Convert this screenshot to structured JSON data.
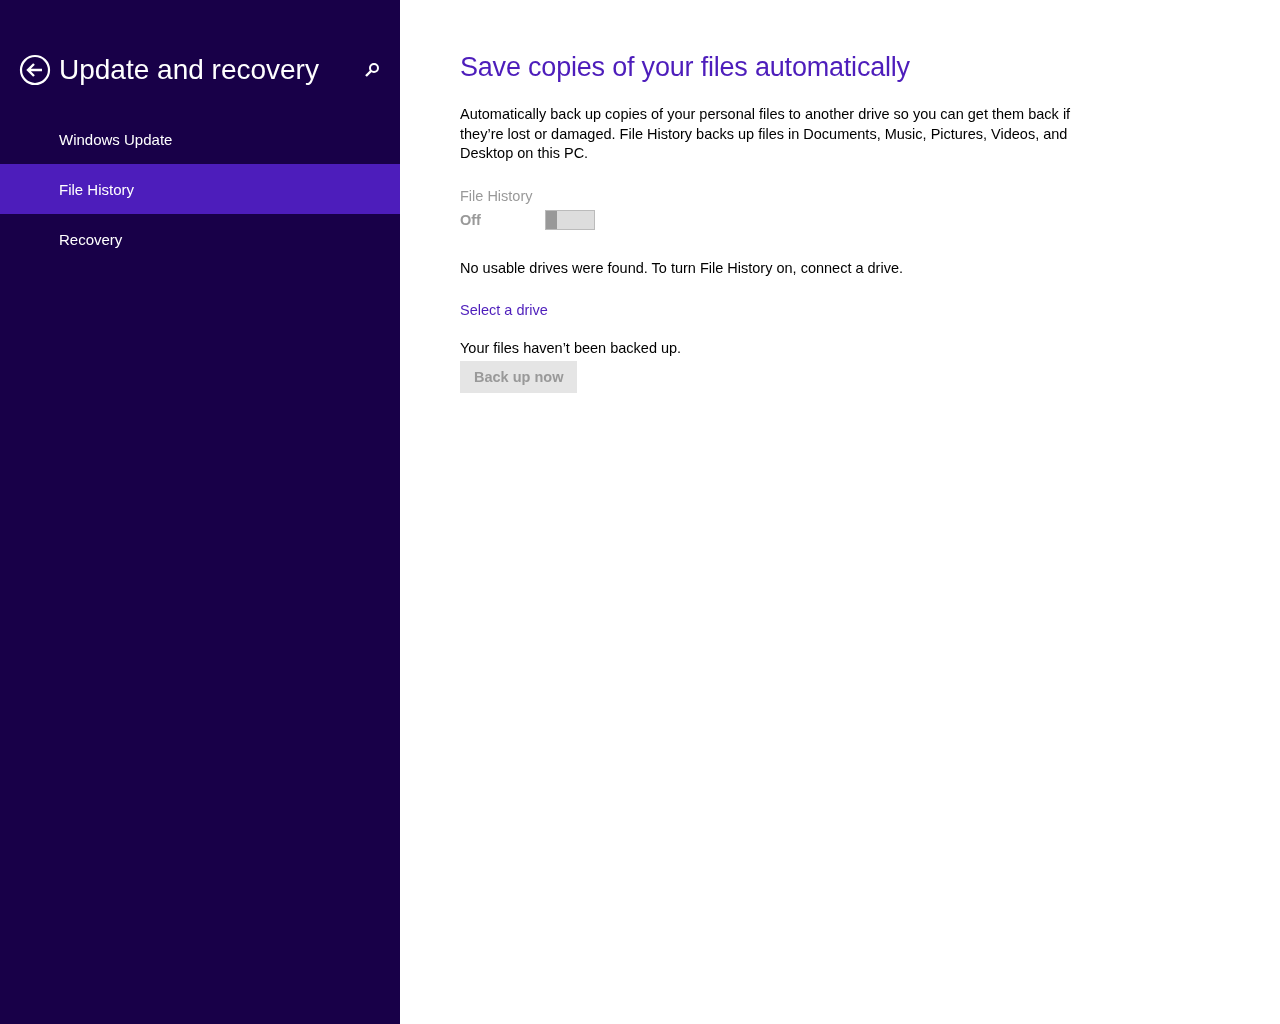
{
  "sidebar": {
    "title": "Update and recovery",
    "items": [
      {
        "label": "Windows Update",
        "selected": false
      },
      {
        "label": "File History",
        "selected": true
      },
      {
        "label": "Recovery",
        "selected": false
      }
    ]
  },
  "main": {
    "heading": "Save copies of your files automatically",
    "description": "Automatically back up copies of your personal files to another drive so you can get them back if they’re lost or damaged. File History backs up files in Documents, Music, Pictures, Videos, and Desktop on this PC.",
    "toggle": {
      "label": "File History",
      "state_text": "Off",
      "on": false,
      "disabled": true
    },
    "message": "No usable drives were found. To turn File History on, connect a drive.",
    "link": "Select a drive",
    "status": "Your files haven’t been backed up.",
    "button": {
      "label": "Back up now",
      "disabled": true
    }
  }
}
